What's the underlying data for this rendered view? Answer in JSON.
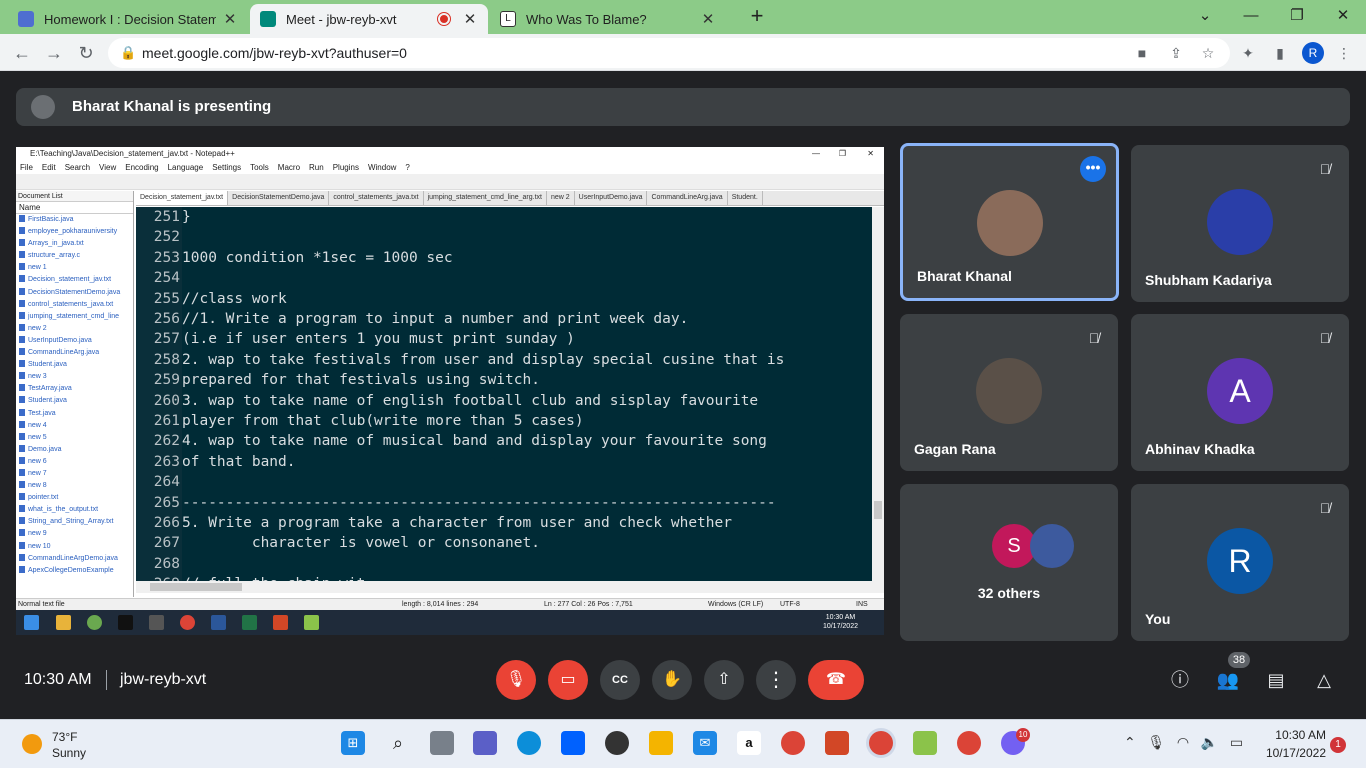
{
  "browser": {
    "tabs": [
      {
        "title": "Homework I : Decision Statement",
        "favicon_color": "#4f6ed0",
        "active": false
      },
      {
        "title": "Meet - jbw-reyb-xvt",
        "favicon_color": "#00897b",
        "active": true,
        "recording": true
      },
      {
        "title": "Who Was To Blame?",
        "favicon_color": "#ffffff",
        "active": false
      }
    ],
    "new_tab": "+",
    "window_controls": {
      "dropdown": "⌄",
      "minimize": "—",
      "restore": "❐",
      "close": "✕"
    },
    "url": "meet.google.com/jbw-reyb-xvt?authuser=0",
    "profile_initial": "R"
  },
  "meet": {
    "presenting_text": "Bharat Khanal is presenting",
    "time": "10:30 AM",
    "meeting_code": "jbw-reyb-xvt",
    "people_count": "38",
    "participants": [
      {
        "name": "Bharat Khanal",
        "speaking": true,
        "avatar_color": "#8a6b5a"
      },
      {
        "name": "Shubham Kadariya",
        "muted": true,
        "avatar_color": "#2a3ea8"
      },
      {
        "name": "Gagan Rana",
        "muted": true,
        "avatar_color": "#5a5048"
      },
      {
        "name": "Abhinav Khadka",
        "muted": true,
        "avatar_initial": "A",
        "avatar_color": "#5e35b1"
      },
      {
        "name": "32 others",
        "avatar_initial": "S",
        "avatar_color": "#c2185b"
      },
      {
        "name": "You",
        "muted": true,
        "avatar_initial": "R",
        "avatar_color": "#0b57a4"
      }
    ]
  },
  "shared_screen": {
    "title": "E:\\Teaching\\Java\\Decision_statement_jav.txt - Notepad++",
    "menu": [
      "File",
      "Edit",
      "Search",
      "View",
      "Encoding",
      "Language",
      "Settings",
      "Tools",
      "Macro",
      "Run",
      "Plugins",
      "Window",
      "?"
    ],
    "doc_panel_title": "Document List",
    "doc_col": "Name",
    "documents": [
      "FirstBasic.java",
      "employee_pokharauniversity",
      "Arrays_in_java.txt",
      "structure_array.c",
      "new 1",
      "Decision_statement_jav.txt",
      "DecisionStatementDemo.java",
      "control_statements_java.txt",
      "jumping_statement_cmd_line",
      "new 2",
      "UserInputDemo.java",
      "CommandLineArg.java",
      "Student.java",
      "new 3",
      "TestArray.java",
      "Student.java",
      "Test.java",
      "new 4",
      "new 5",
      "Demo.java",
      "new 6",
      "new 7",
      "new 8",
      "pointer.txt",
      "what_is_the_output.txt",
      "String_and_String_Array.txt",
      "new 9",
      "new 10",
      "CommandLineArgDemo.java",
      "ApexCollegeDemoExample"
    ],
    "tabs": [
      "Decision_statement_jav.txt",
      "DecisionStatementDemo.java",
      "control_statements_java.txt",
      "jumping_statement_cmd_line_arg.txt",
      "new 2",
      "UserInputDemo.java",
      "CommandLineArg.java",
      "Student."
    ],
    "lines": [
      {
        "n": "251",
        "t": "}"
      },
      {
        "n": "252",
        "t": ""
      },
      {
        "n": "253",
        "t": "1000 condition *1sec = 1000 sec"
      },
      {
        "n": "254",
        "t": ""
      },
      {
        "n": "255",
        "t": "//class work"
      },
      {
        "n": "256",
        "t": "//1. Write a program to input a number and print week day."
      },
      {
        "n": "257",
        "t": "(i.e if user enters 1 you must print sunday )"
      },
      {
        "n": "258",
        "t": "2. wap to take festivals from user and display special cusine that is"
      },
      {
        "n": "259",
        "t": "prepared for that festivals using switch."
      },
      {
        "n": "260",
        "t": "3. wap to take name of english football club and sisplay favourite"
      },
      {
        "n": "261",
        "t": "player from that club(write more than 5 cases)"
      },
      {
        "n": "262",
        "t": "4. wap to take name of musical band and display your favourite song"
      },
      {
        "n": "263",
        "t": "of that band."
      },
      {
        "n": "264",
        "t": ""
      },
      {
        "n": "265",
        "t": "--------------------------------------------------------------------"
      },
      {
        "n": "266",
        "t": "5. Write a program take a character from user and check whether"
      },
      {
        "n": "267",
        "t": "        character is vowel or consonanet."
      },
      {
        "n": "268",
        "t": ""
      },
      {
        "n": "269",
        "t": "// full the chain wit..."
      }
    ],
    "status": {
      "type": "Normal text file",
      "length": "length : 8,014    lines : 294",
      "pos": "Ln : 277    Col : 26    Pos : 7,751",
      "eol": "Windows (CR LF)",
      "enc": "UTF-8",
      "mode": "INS"
    },
    "clock_time": "10:30 AM",
    "clock_date": "10/17/2022"
  },
  "taskbar": {
    "temperature": "73°F",
    "condition": "Sunny",
    "time": "10:30 AM",
    "date": "10/17/2022",
    "notifications": "1",
    "viber_badge": "10"
  }
}
